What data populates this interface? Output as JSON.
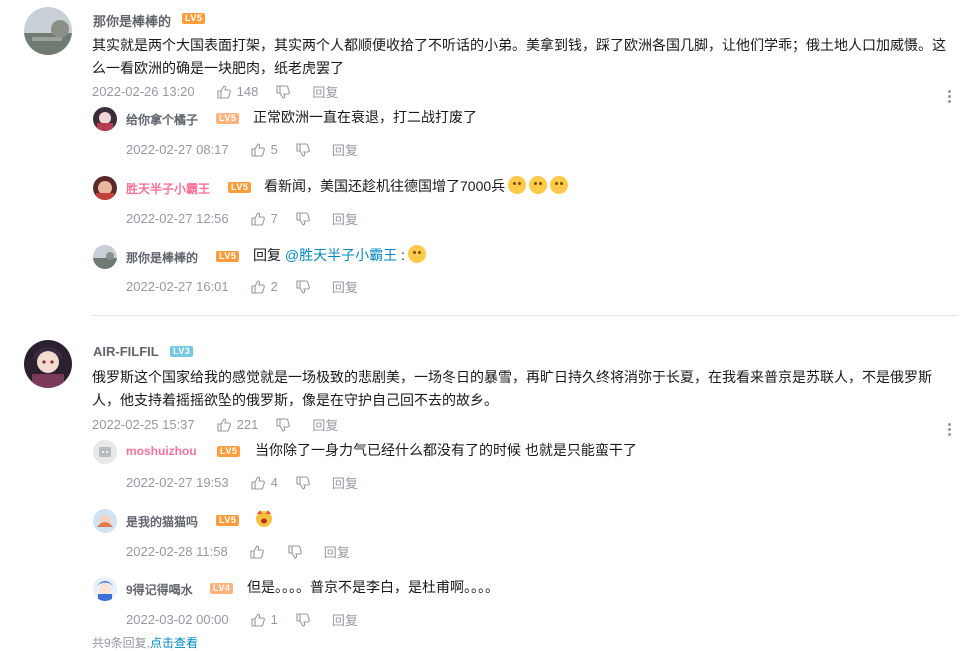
{
  "comments": [
    {
      "user": "那你是棒棒的",
      "level": "LV5",
      "text": "其实就是两个大国表面打架，其实两个人都顺便收拾了不听话的小弟。美拿到钱，踩了欧洲各国几脚，让他们学乖；俄土地人口加威慑。这么一看欧洲的确是一块肥肉，纸老虎罢了",
      "time": "2022-02-26 13:20",
      "likes": "148",
      "reply_label": "回复",
      "replies": [
        {
          "user": "给你拿个橘子",
          "level": "LV5",
          "text": "正常欧洲一直在衰退，打二战打废了",
          "time": "2022-02-27 08:17",
          "likes": "5",
          "reply_label": "回复"
        },
        {
          "user": "胜天半子小霸王",
          "level": "LV5",
          "text": "看新闻，美国还趁机往德国增了7000兵",
          "time": "2022-02-27 12:56",
          "likes": "7",
          "reply_label": "回复"
        },
        {
          "user": "那你是棒棒的",
          "level": "LV5",
          "text_prefix": "回复",
          "mention": "@胜天半子小霸王",
          "text_suffix": " :",
          "time": "2022-02-27 16:01",
          "likes": "2",
          "reply_label": "回复"
        }
      ]
    },
    {
      "user": "AIR-FILFIL",
      "level": "LV3",
      "text": "俄罗斯这个国家给我的感觉就是一场极致的悲剧美，一场冬日的暴雪，再旷日持久终将消弥于长夏，在我看来普京是苏联人，不是俄罗斯人，他支持着摇摇欲坠的俄罗斯，像是在守护自己回不去的故乡。",
      "time": "2022-02-25 15:37",
      "likes": "221",
      "reply_label": "回复",
      "replies": [
        {
          "user": "moshuizhou",
          "level": "LV5",
          "text": "当你除了一身力气已经什么都没有了的时候 也就是只能蛮干了",
          "time": "2022-02-27 19:53",
          "likes": "4",
          "reply_label": "回复"
        },
        {
          "user": "是我的猫猫吗",
          "level": "LV5",
          "text": "",
          "time": "2022-02-28 11:58",
          "likes": "",
          "reply_label": "回复"
        },
        {
          "user": "9得记得喝水",
          "level": "LV4",
          "text": "但是。。。。普京不是李白，是杜甫啊。。。。",
          "time": "2022-03-02 00:00",
          "likes": "1",
          "reply_label": "回复"
        }
      ]
    }
  ],
  "footer_cut": {
    "prefix": "共9条回复,",
    "link": "点击查看"
  }
}
